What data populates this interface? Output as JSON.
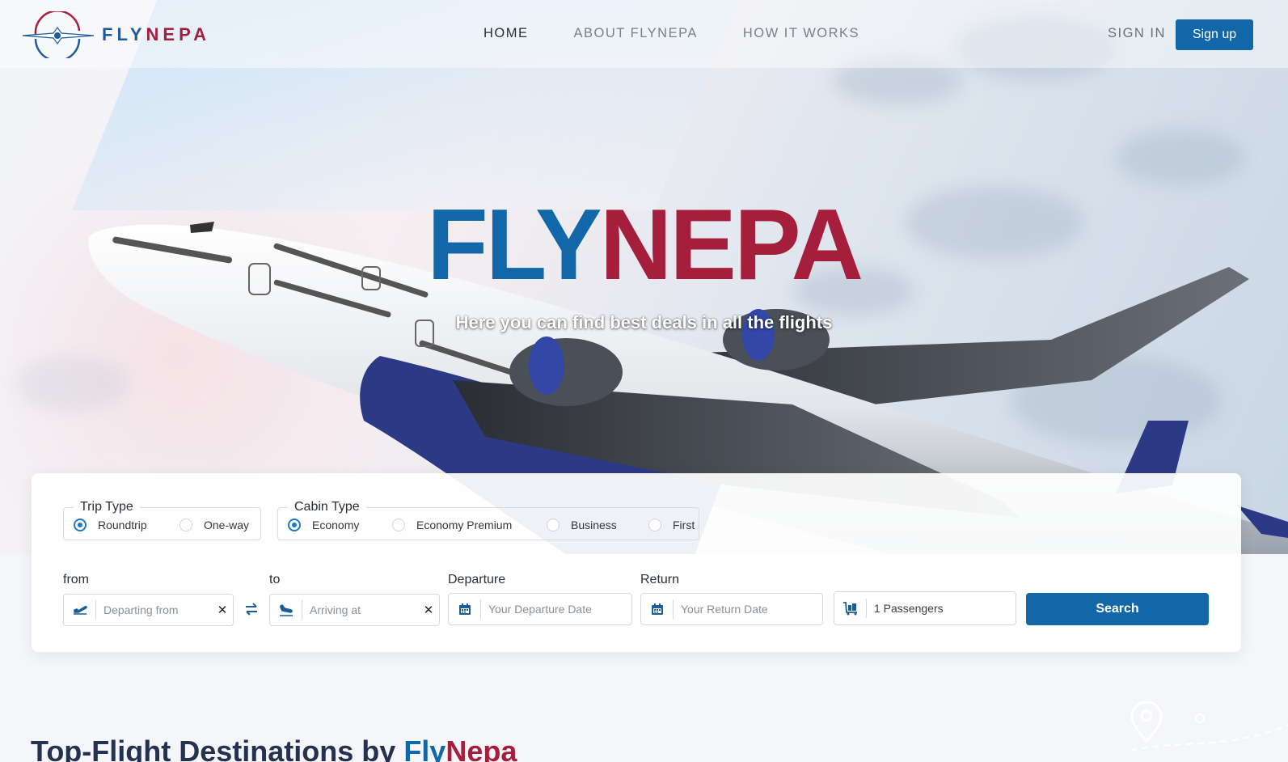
{
  "brand": {
    "logo_part1": "FLY",
    "logo_part2": "NEPA",
    "colors": {
      "blue": "#1267a8",
      "red": "#a51f3c"
    }
  },
  "nav": {
    "links": [
      "HOME",
      "ABOUT FLYNEPA",
      "HOW IT WORKS"
    ],
    "active": "HOME",
    "signin": "SIGN IN",
    "signup": "Sign up"
  },
  "hero": {
    "title_part1": "FLY",
    "title_part2": "NEPA",
    "subtitle": "Here you can find best deals in all the flights"
  },
  "search": {
    "trip_type": {
      "legend": "Trip Type",
      "options": [
        "Roundtrip",
        "One-way"
      ],
      "selected": "Roundtrip"
    },
    "cabin_type": {
      "legend": "Cabin Type",
      "options": [
        "Economy",
        "Economy Premium",
        "Business",
        "First"
      ],
      "selected": "Economy"
    },
    "from": {
      "label": "from",
      "placeholder": "Departing from",
      "icon": "takeoff-icon"
    },
    "to": {
      "label": "to",
      "placeholder": "Arriving at",
      "icon": "landing-icon"
    },
    "departure": {
      "label": "Departure",
      "placeholder": "Your Departure Date",
      "icon": "calendar-icon"
    },
    "return": {
      "label": "Return",
      "placeholder": "Your Return Date",
      "icon": "calendar-icon"
    },
    "passengers": {
      "value": "1 Passengers",
      "icon": "luggage-icon"
    },
    "button": "Search"
  },
  "section": {
    "title_prefix": "Top-Flight Destinations by ",
    "title_blue": "Fly",
    "title_red": "Nepa"
  }
}
